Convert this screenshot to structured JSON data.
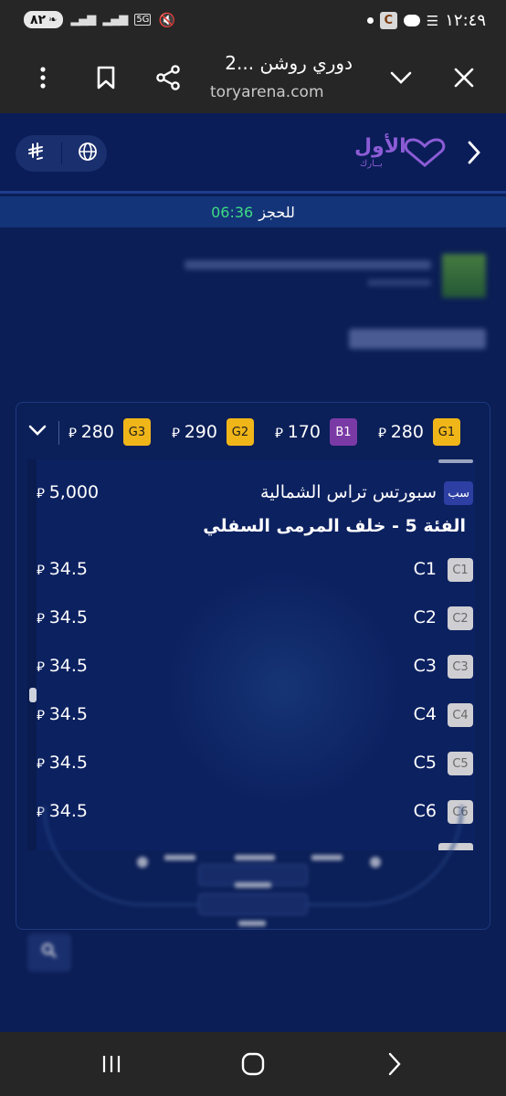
{
  "status_bar": {
    "battery": "٨٢",
    "network": "5G",
    "time": "١٢:٤٩",
    "notif_c": "C"
  },
  "browser": {
    "title": "دوري روشن ...2",
    "url": "toryarena.com",
    "icons": [
      "menu-kebab-icon",
      "bookmark-icon",
      "share-icon",
      "chevron-down-icon",
      "close-icon"
    ]
  },
  "header": {
    "logo_text": "الأول",
    "logo_sub": "بــارك",
    "currency_symbol": "⃁",
    "icons": [
      "chevron-right-icon",
      "riyal-icon",
      "globe-icon"
    ]
  },
  "timer": {
    "time": "06:36",
    "label": "للحجز"
  },
  "categories": [
    {
      "code": "G1",
      "price": "280",
      "color": "#f0b619"
    },
    {
      "code": "B1",
      "price": "170",
      "color": "#7a3aa6"
    },
    {
      "code": "G2",
      "price": "290",
      "color": "#f0b619"
    },
    {
      "code": "G3",
      "price": "280",
      "color": "#f0b619"
    }
  ],
  "supporters_row": {
    "badge": "سب",
    "name": "سبورتس تراس الشمالية",
    "price": "5,000"
  },
  "section": {
    "title": "الفئة 5 - خلف المرمى السفلي",
    "rows": [
      {
        "badge": "C1",
        "name": "C1",
        "price": "34.5"
      },
      {
        "badge": "C2",
        "name": "C2",
        "price": "34.5"
      },
      {
        "badge": "C3",
        "name": "C3",
        "price": "34.5"
      },
      {
        "badge": "C4",
        "name": "C4",
        "price": "34.5"
      },
      {
        "badge": "C5",
        "name": "C5",
        "price": "34.5"
      },
      {
        "badge": "C6",
        "name": "C6",
        "price": "34.5"
      }
    ]
  },
  "colors": {
    "background": "#0b1e55",
    "accent_green": "#3ddc84",
    "logo_purple": "#8c5cd6",
    "badge_gold": "#f0b619",
    "badge_purple": "#7a3aa6"
  }
}
